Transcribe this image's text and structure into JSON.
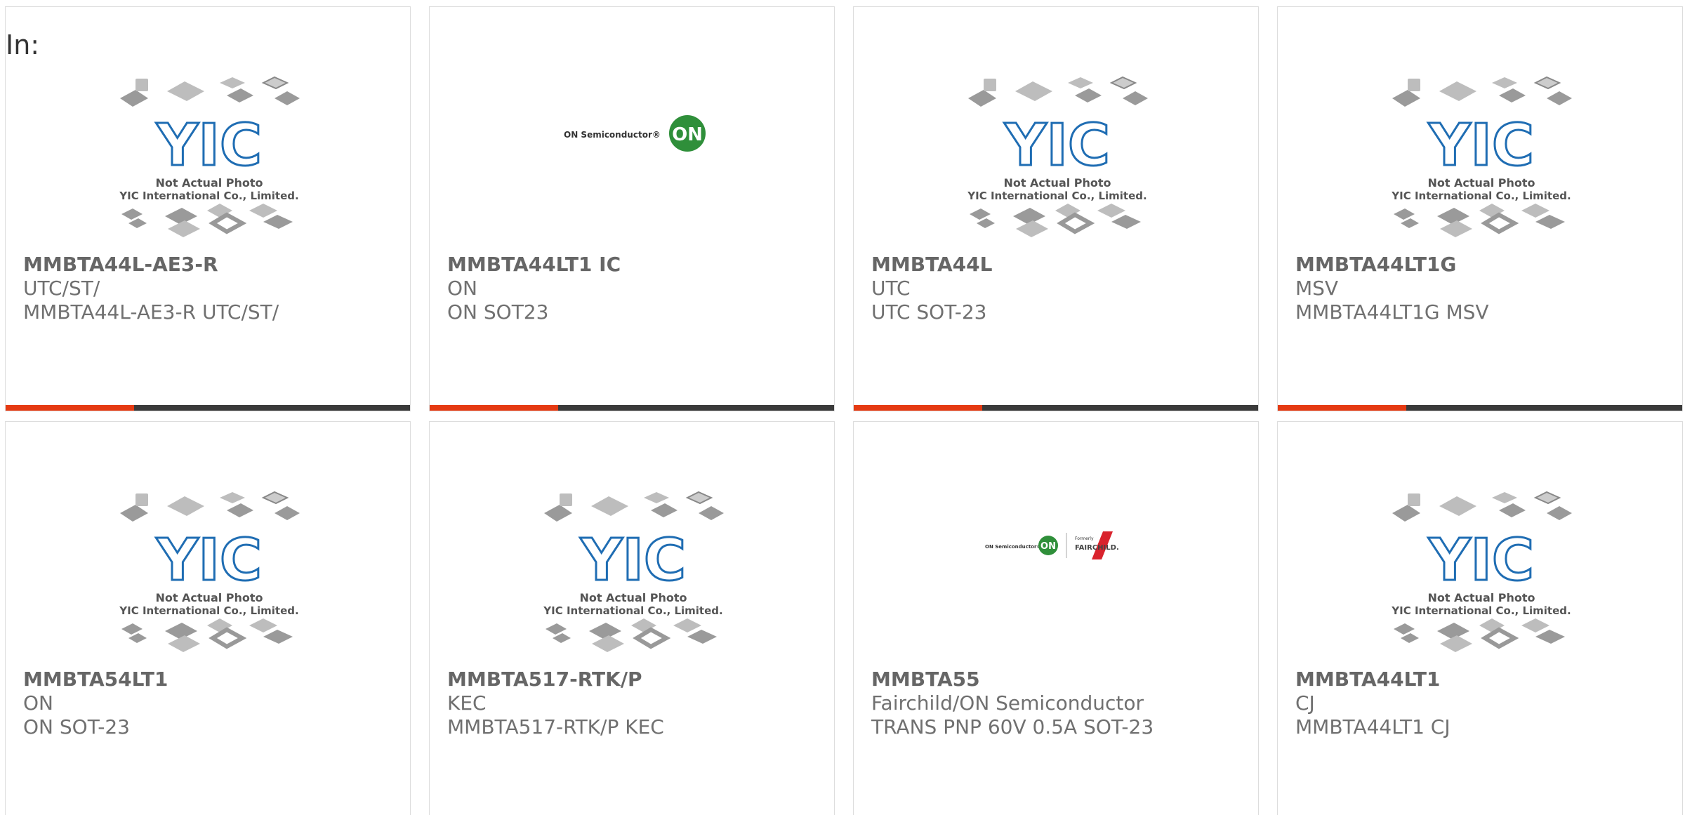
{
  "header": {
    "label": "In:"
  },
  "placeholder": {
    "line1": "Not Actual Photo",
    "line2": "YIC International Co., Limited.",
    "logo_text": "YIC"
  },
  "colors": {
    "accent": "#e53a12",
    "bar": "#3a3a3a",
    "yic_blue": "#1f6db3",
    "on_green": "#2f8f3a"
  },
  "products": [
    {
      "part": "MMBTA44L-AE3-R",
      "brand": "UTC/ST/",
      "desc": "MMBTA44L-AE3-R UTC/ST/",
      "image": "yic-placeholder",
      "bar": true
    },
    {
      "part": "MMBTA44LT1 IC",
      "brand": "ON",
      "desc": "ON SOT23",
      "image": "on-semiconductor-logo",
      "bar": true
    },
    {
      "part": "MMBTA44L",
      "brand": "UTC",
      "desc": "UTC SOT-23",
      "image": "yic-placeholder",
      "bar": true
    },
    {
      "part": "MMBTA44LT1G",
      "brand": "MSV",
      "desc": "MMBTA44LT1G MSV",
      "image": "yic-placeholder",
      "bar": true
    },
    {
      "part": "MMBTA54LT1",
      "brand": "ON",
      "desc": "ON SOT-23",
      "image": "yic-placeholder",
      "bar": false
    },
    {
      "part": "MMBTA517-RTK/P",
      "brand": "KEC",
      "desc": "MMBTA517-RTK/P KEC",
      "image": "yic-placeholder",
      "bar": false
    },
    {
      "part": "MMBTA55",
      "brand": "Fairchild/ON Semiconductor",
      "desc": "TRANS PNP 60V 0.5A SOT-23",
      "image": "on-fairchild-logo",
      "bar": false
    },
    {
      "part": "MMBTA44LT1",
      "brand": "CJ",
      "desc": "MMBTA44LT1 CJ",
      "image": "yic-placeholder",
      "bar": false
    }
  ]
}
